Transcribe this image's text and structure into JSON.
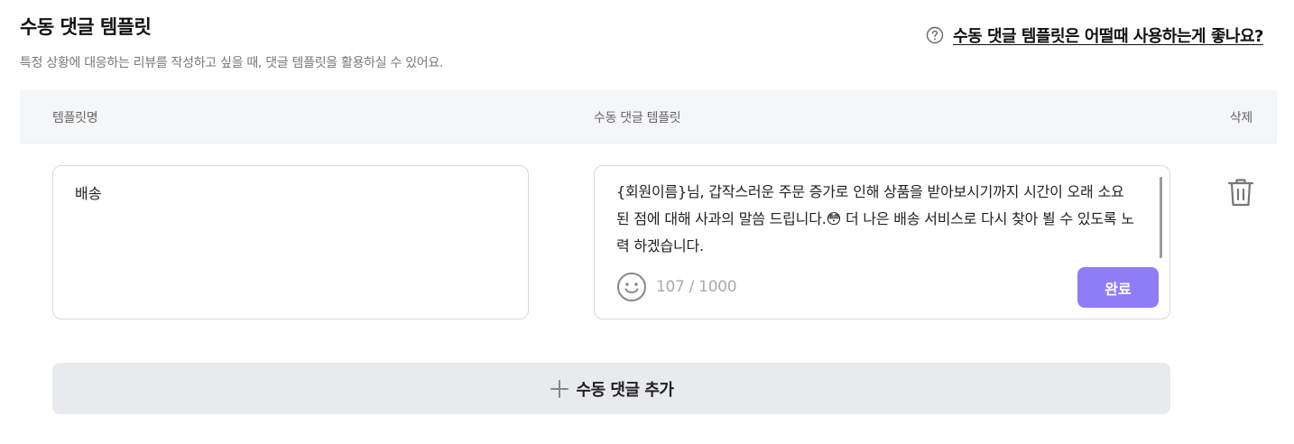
{
  "header": {
    "title": "수동 댓글 템플릿",
    "subtitle": "특정 상황에 대응하는 리뷰를 작성하고 싶을 때, 댓글 템플릿을 활용하실 수 있어요.",
    "help_link": "수동 댓글 템플릿은 어떨때 사용하는게 좋나요?"
  },
  "table": {
    "columns": {
      "name": "템플릿명",
      "template": "수동 댓글 템플릿",
      "delete": "삭제"
    },
    "rows": [
      {
        "name": "배송",
        "template_text": "{회원이름}님, 갑작스러운 주문 증가로 인해 상품을 받아보시기까지 시간이 오래 소요 된 점에 대해 사과의 말씀 드립니다.😳 더 나은 배송 서비스로 다시 찾아 뵐 수 있도록 노력 하겠습니다.",
        "char_count": "107 / 1000",
        "done_label": "완료"
      }
    ]
  },
  "add_button": {
    "label": "수동 댓글 추가"
  },
  "colors": {
    "accent": "#8f7df6",
    "header_bg": "#f5f6f8",
    "add_bg": "#e8eaed"
  }
}
